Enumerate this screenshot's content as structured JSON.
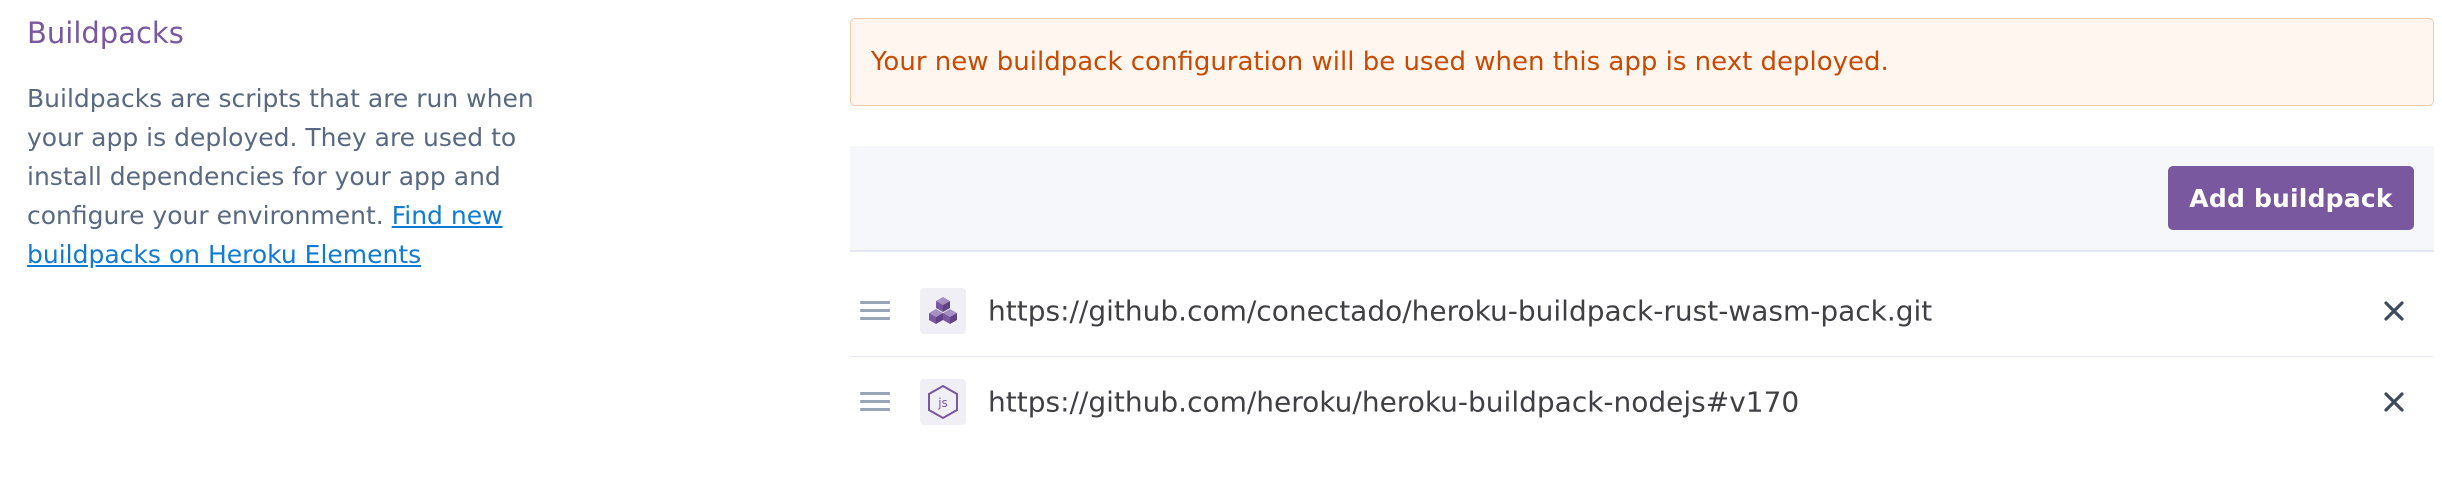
{
  "section": {
    "title": "Buildpacks",
    "description": "Buildpacks are scripts that are run when your app is deployed. They are used to install dependencies for your app and configure your environment. ",
    "link_text": "Find new buildpacks on Heroku Elements"
  },
  "notice": {
    "text": "Your new buildpack configuration will be used when this app is next deployed."
  },
  "toolbar": {
    "add_label": "Add buildpack"
  },
  "buildpacks": [
    {
      "url": "https://github.com/conectado/heroku-buildpack-rust-wasm-pack.git",
      "icon": "cubes-icon"
    },
    {
      "url": "https://github.com/heroku/heroku-buildpack-nodejs#v170",
      "icon": "nodejs-icon"
    }
  ],
  "colors": {
    "accent": "#79589f",
    "link": "#0f7bd4",
    "warning_text": "#c94b02",
    "warning_bg": "#fff6f0"
  }
}
